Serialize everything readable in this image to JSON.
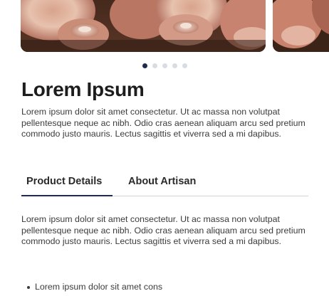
{
  "product": {
    "title": "Lorem Ipsum",
    "description": "Lorem ipsum dolor sit amet consectetur. Ut ac massa non volutpat pellentesque neque ac nibh. Odio cras aenean aliquam arcu sed pretium commodo justo mauris. Lectus sagittis et viverra sed a mi dapibus."
  },
  "carousel": {
    "slide_count": 5,
    "active_index": 0
  },
  "tabs": [
    {
      "label": "Product Details",
      "active": true
    },
    {
      "label": "About Artisan",
      "active": false
    }
  ],
  "details": {
    "text": "Lorem ipsum dolor sit amet consectetur. Ut ac massa non volutpat pellentesque neque ac nibh. Odio cras aenean aliquam arcu sed pretium commodo justo mauris. Lectus sagittis et viverra sed a mi dapibus.",
    "bullets": [
      "Lorem ipsum dolor sit amet cons"
    ]
  },
  "colors": {
    "accent": "#1f2d4d",
    "dot_inactive": "#d9dde2",
    "divider": "#cfd3d8"
  }
}
